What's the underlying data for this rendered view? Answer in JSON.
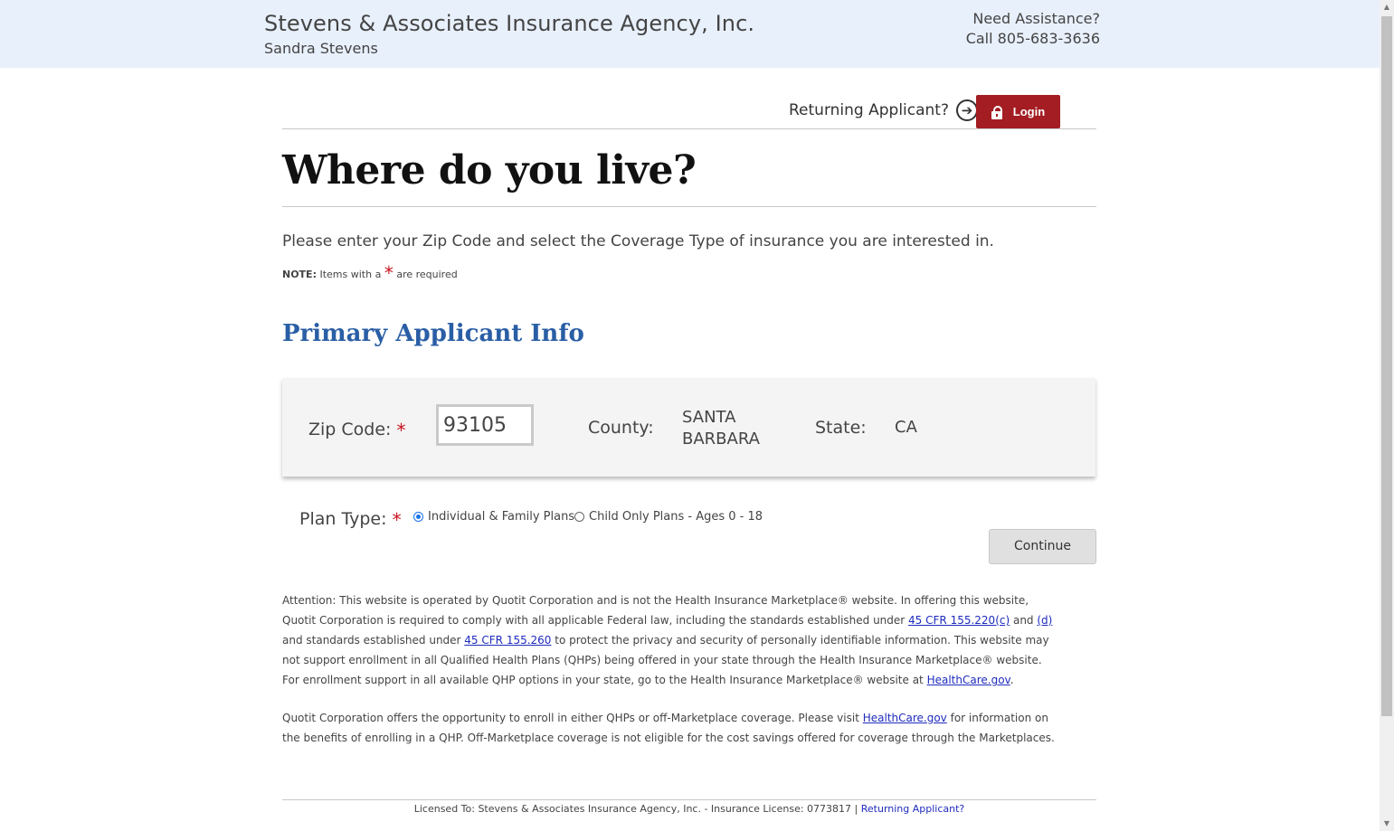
{
  "header": {
    "agency_name": "Stevens & Associates Insurance Agency, Inc.",
    "agent_name": "Sandra Stevens",
    "assistance_line1": "Need Assistance?",
    "assistance_line2": "Call 805-683-3636"
  },
  "auth": {
    "returning_label": "Returning Applicant?",
    "login_label": "Login"
  },
  "page": {
    "title": "Where do you live?",
    "intro": "Please enter your Zip Code and select the Coverage Type of insurance you are interested in.",
    "note_prefix": "NOTE:",
    "note_middle": "Items with a",
    "note_star": "*",
    "note_suffix": "are required"
  },
  "primary_info": {
    "section_title": "Primary Applicant Info",
    "zip_label": "Zip Code:",
    "zip_value": "93105",
    "county_label": "County:",
    "county_value": "SANTA BARBARA",
    "state_label": "State:",
    "state_value": "CA"
  },
  "plan": {
    "label": "Plan Type:",
    "options": [
      {
        "label": "Individual & Family Plans",
        "selected": true
      },
      {
        "label": "Child Only Plans - Ages 0 - 18",
        "selected": false
      }
    ],
    "continue_label": "Continue"
  },
  "disclaimer": {
    "p1_a": "Attention: This website is operated by Quotit Corporation and is not the Health Insurance Marketplace® website. In offering this website, Quotit Corporation is required to comply with all applicable Federal law, including the standards established under ",
    "link_cfr1": "45 CFR 155.220(c)",
    "p1_b": " and ",
    "link_d": "(d)",
    "p1_c": " and standards established under ",
    "link_cfr2": "45 CFR 155.260",
    "p1_d": " to protect the privacy and security of personally identifiable information. This website may not support enrollment in all Qualified Health Plans (QHPs) being offered in your state through the Health Insurance Marketplace® website. For enrollment support in all available QHP options in your state, go to the Health Insurance Marketplace® website at ",
    "link_hc1": "HealthCare.gov",
    "p1_e": ".",
    "p2_a": "Quotit Corporation offers the opportunity to enroll in either QHPs or off-Marketplace coverage. Please visit ",
    "link_hc2": "HealthCare.gov",
    "p2_b": " for information on the benefits of enrolling in a QHP. Off-Marketplace coverage is not eligible for the cost savings offered for coverage through the Marketplaces."
  },
  "footer": {
    "license_text": "Licensed To: Stevens & Associates Insurance Agency, Inc. - Insurance License: 0773817 |",
    "returning_link": "Returning Applicant?"
  },
  "colors": {
    "header_bg": "#e8f0fc",
    "login_bg": "#a31d22",
    "section_title": "#2a5ea5",
    "required_star": "#c8141e",
    "link": "#1f2cbd"
  }
}
